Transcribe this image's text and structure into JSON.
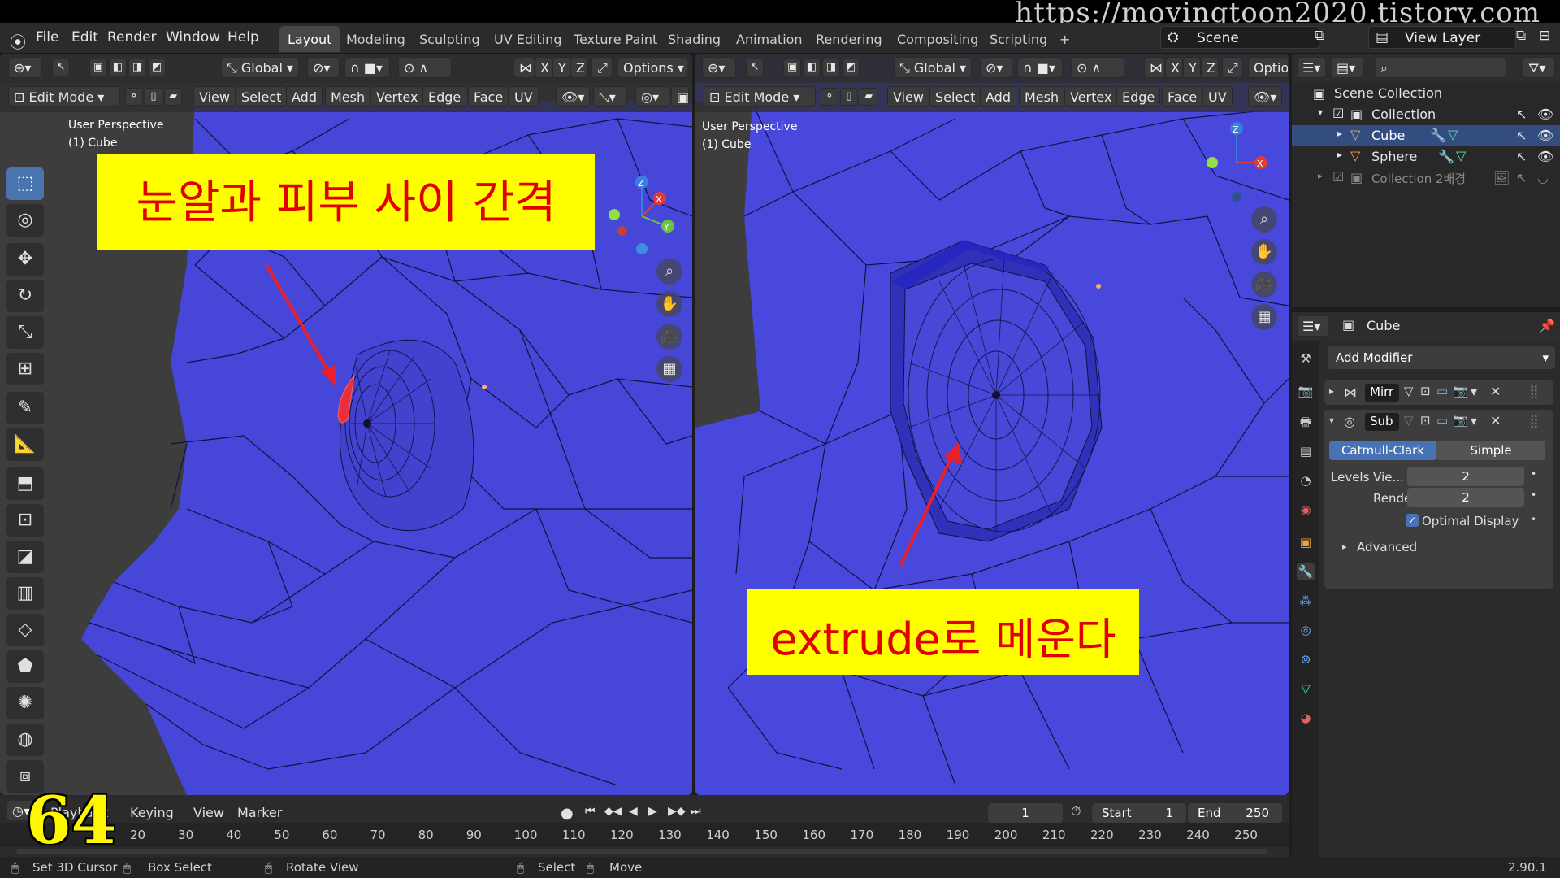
{
  "watermark": "https://movingtoon2020.tistory.com",
  "menubar": {
    "items": [
      "File",
      "Edit",
      "Render",
      "Window",
      "Help"
    ],
    "workspaces": [
      "Layout",
      "Modeling",
      "Sculpting",
      "UV Editing",
      "Texture Paint",
      "Shading",
      "Animation",
      "Rendering",
      "Compositing",
      "Scripting"
    ],
    "active_workspace": "Layout",
    "scene": "Scene",
    "view_layer": "View Layer"
  },
  "viewport_left": {
    "transform_orientation": "Global",
    "options": "Options",
    "mode": "Edit Mode",
    "menus": [
      "View",
      "Select",
      "Add",
      "Mesh",
      "Vertex",
      "Edge",
      "Face",
      "UV"
    ],
    "axes": [
      "X",
      "Y",
      "Z"
    ],
    "perspective": "User Perspective",
    "object": "(1) Cube",
    "annotation": "눈알과 피부 사이 간격"
  },
  "viewport_right": {
    "transform_orientation": "Global",
    "options": "Optio",
    "mode": "Edit Mode",
    "menus": [
      "View",
      "Select",
      "Add",
      "Mesh",
      "Vertex",
      "Edge",
      "Face",
      "UV"
    ],
    "axes": [
      "X",
      "Y",
      "Z"
    ],
    "perspective": "User Perspective",
    "object": "(1) Cube",
    "annotation": "extrude로 메운다"
  },
  "gizmo": {
    "x": "X",
    "y": "Y",
    "z": "Z"
  },
  "outliner": {
    "root": "Scene Collection",
    "items": [
      {
        "name": "Collection",
        "level": 1
      },
      {
        "name": "Cube",
        "level": 2,
        "selected": true
      },
      {
        "name": "Sphere",
        "level": 2
      },
      {
        "name": "Collection 2배경",
        "level": 1,
        "dim": true
      }
    ]
  },
  "properties": {
    "object": "Cube",
    "add_modifier": "Add Modifier",
    "modifiers": [
      "Mirr",
      "Sub"
    ],
    "subdiv_types": [
      "Catmull-Clark",
      "Simple"
    ],
    "active_type": "Catmull-Clark",
    "levels_label": "Levels Vie...",
    "levels_value": "2",
    "render_label": "Render",
    "render_value": "2",
    "optimal_display": "Optimal Display",
    "advanced": "Advanced"
  },
  "timeline": {
    "playback": "Playback",
    "keying": "Keying",
    "view": "View",
    "marker": "Marker",
    "current_frame": "1",
    "start_label": "Start",
    "start": "1",
    "end_label": "End",
    "end": "250",
    "ruler": [
      "20",
      "30",
      "40",
      "50",
      "60",
      "70",
      "80",
      "90",
      "100",
      "110",
      "120",
      "130",
      "140",
      "150",
      "160",
      "170",
      "180",
      "190",
      "200",
      "210",
      "220",
      "230",
      "240",
      "250"
    ]
  },
  "statusbar": {
    "items": [
      "Set 3D Cursor",
      "Box Select",
      "Rotate View",
      "Select",
      "Move"
    ],
    "version": "2.90.1"
  },
  "page_number": "64",
  "colors": {
    "mesh": "#4646d8",
    "annotation_bg": "#ffff00",
    "annotation_text": "#e00000",
    "selected": "#4772b3",
    "arrow": "#e8202a"
  }
}
